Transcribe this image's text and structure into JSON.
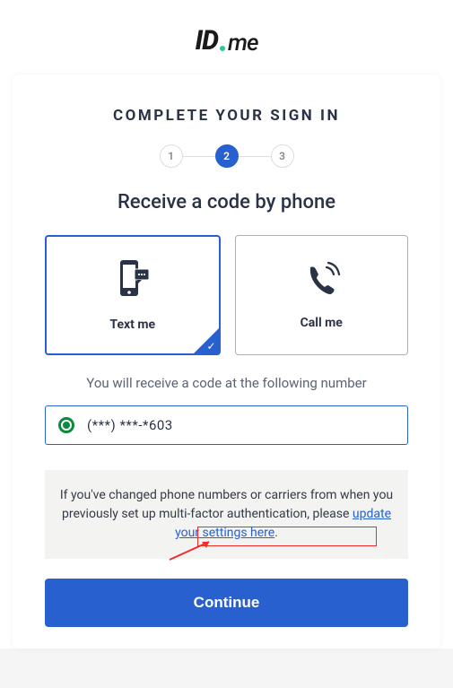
{
  "logo": {
    "id": "ID",
    "me": "me"
  },
  "heading": "COMPLETE YOUR SIGN IN",
  "stepper": {
    "steps": [
      "1",
      "2",
      "3"
    ],
    "activeIndex": 1
  },
  "subheading": "Receive a code by phone",
  "options": {
    "text": {
      "label": "Text me",
      "selected": true
    },
    "call": {
      "label": "Call me",
      "selected": false
    }
  },
  "infoText": "You will receive a code at the following number",
  "phones": [
    {
      "masked": "(***) ***-*603",
      "selected": true
    }
  ],
  "notice": {
    "prefix": "If you've changed phone numbers or carriers from when you previously set up multi-factor authentication, please ",
    "linkText": "update your settings here",
    "suffix": "."
  },
  "continueLabel": "Continue"
}
